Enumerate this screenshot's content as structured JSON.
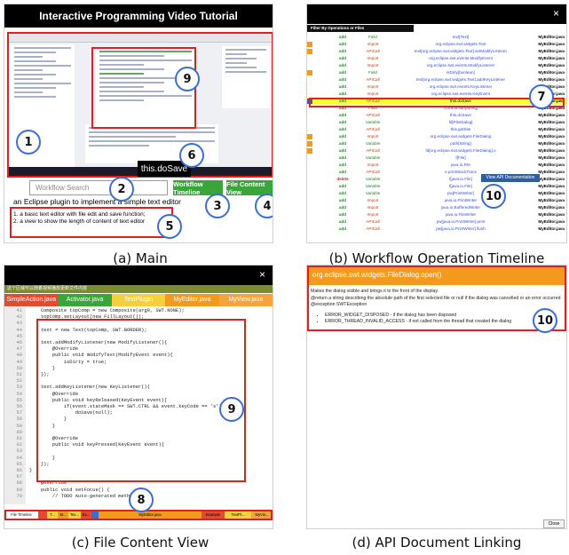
{
  "captions": {
    "a": "(a) Main",
    "b": "(b) Workflow Operation Timeline",
    "c": "(c) File Content View",
    "d": "(d) API Document Linking"
  },
  "panel_a": {
    "title": "Interactive Programming Video Tutorial",
    "tooltip": "this.doSave",
    "search_placeholder": "Workflow Search",
    "btn_timeline": "Workflow Timeline",
    "btn_filecontent": "File Content View",
    "desc_main": "an Eclipse plugin to implement a simple text editor",
    "desc_1": "1. a basic text editor with file edit and save function;",
    "desc_2": "2. a view to show the length of content of text editor",
    "accent": "#3aa63a"
  },
  "panel_b": {
    "close_glyph": "×",
    "filter_label": "Filter By Operations or Files",
    "popup": "View API Documentation",
    "rows": [
      {
        "action": "add",
        "kind": "Field",
        "detail": "text[Text]",
        "file": "MyEditor.java",
        "mark": ""
      },
      {
        "action": "add",
        "kind": "Import",
        "detail": "org.eclipse.swt.widgets.Text",
        "file": "MyEditor.java",
        "mark": "#f29a1e"
      },
      {
        "action": "add",
        "kind": "APICall",
        "detail": "text[org.eclipse.swt.widgets.Text].setModifyListener",
        "file": "MyEditor.java",
        "mark": "#f29a1e"
      },
      {
        "action": "add",
        "kind": "Import",
        "detail": "org.eclipse.swt.events.ModifyEvent",
        "file": "MyEditor.java",
        "mark": ""
      },
      {
        "action": "add",
        "kind": "Import",
        "detail": "org.eclipse.swt.events.ModifyListener",
        "file": "MyEditor.java",
        "mark": ""
      },
      {
        "action": "add",
        "kind": "Field",
        "detail": "isDirty[boolean]",
        "file": "MyEditor.java",
        "mark": "#f29a1e"
      },
      {
        "action": "add",
        "kind": "APICall",
        "detail": "text[org.eclipse.swt.widgets.Text].addKeyListener",
        "file": "MyEditor.java",
        "mark": ""
      },
      {
        "action": "add",
        "kind": "Import",
        "detail": "org.eclipse.swt.events.KeyListener",
        "file": "MyEditor.java",
        "mark": ""
      },
      {
        "action": "add",
        "kind": "Import",
        "detail": "org.eclipse.swt.events.KeyEvent",
        "file": "MyEditor.java",
        "mark": ""
      },
      {
        "action": "add",
        "kind": "APICall",
        "detail": "this.doSave",
        "file": "MyEditor.java",
        "mark": "#2a5fd8",
        "highlight": true
      },
      {
        "action": "add",
        "kind": "Field",
        "detail": "currentPath[String]",
        "file": "MyEditor.java",
        "mark": ""
      },
      {
        "action": "add",
        "kind": "APICall",
        "detail": "this.doSave",
        "file": "MyEditor.java",
        "mark": ""
      },
      {
        "action": "add",
        "kind": "Variable",
        "detail": "fd[FileDialog]",
        "file": "MyEditor.java",
        "mark": ""
      },
      {
        "action": "add",
        "kind": "APICall",
        "detail": "this.getSite",
        "file": "MyEditor.java",
        "mark": ""
      },
      {
        "action": "add",
        "kind": "Import",
        "detail": "org.eclipse.swt.widgets.FileDialog",
        "file": "MyEditor.java",
        "mark": "#f29a1e"
      },
      {
        "action": "add",
        "kind": "Variable",
        "detail": "path[String]",
        "file": "MyEditor.java",
        "mark": "#f29a1e"
      },
      {
        "action": "add",
        "kind": "APICall",
        "detail": "fd[org.eclipse.swt.widgets.FileDialog].o",
        "file": "MyEditor.java",
        "mark": "#f29a1e"
      },
      {
        "action": "add",
        "kind": "Variable",
        "detail": "f[File]",
        "file": "MyEditor.java",
        "mark": ""
      },
      {
        "action": "add",
        "kind": "Import",
        "detail": "java.io.File",
        "file": "MyEditor.java",
        "mark": ""
      },
      {
        "action": "add",
        "kind": "APICall",
        "detail": "e.printStackTrace",
        "file": "MyEditor.java",
        "mark": ""
      },
      {
        "action": "delete",
        "kind": "Variable",
        "detail": "f[java.io.File]",
        "file": "MyEditor.java",
        "mark": ""
      },
      {
        "action": "add",
        "kind": "Variable",
        "detail": "f[java.io.File]",
        "file": "MyEditor.java",
        "mark": ""
      },
      {
        "action": "add",
        "kind": "Variable",
        "detail": "pw[PrintWriter]",
        "file": "MyEditor.java",
        "mark": ""
      },
      {
        "action": "add",
        "kind": "Import",
        "detail": "java.io.PrintWriter",
        "file": "MyEditor.java",
        "mark": ""
      },
      {
        "action": "add",
        "kind": "Import",
        "detail": "java.io.BufferedWriter",
        "file": "MyEditor.java",
        "mark": ""
      },
      {
        "action": "add",
        "kind": "Import",
        "detail": "java.io.FileWriter",
        "file": "MyEditor.java",
        "mark": ""
      },
      {
        "action": "add",
        "kind": "APICall",
        "detail": "pw[java.io.PrintWriter].print",
        "file": "MyEditor.java",
        "mark": ""
      },
      {
        "action": "add",
        "kind": "APICall",
        "detail": "pw[java.io.PrintWriter].flush",
        "file": "MyEditor.java",
        "mark": ""
      }
    ]
  },
  "panel_c": {
    "close_glyph": "×",
    "banner": "这个区域可以随着视频播放更新文件内容",
    "tabs": [
      {
        "label": "SimpleAction.java",
        "color": "#e34a2f"
      },
      {
        "label": "Activator.java",
        "color": "#3aa63a"
      },
      {
        "label": "TextPlugin",
        "color": "#f4d03f"
      },
      {
        "label": "MyEditor.java",
        "color": "#f29a1e"
      },
      {
        "label": "MyView.java",
        "color": "#f4a43a"
      }
    ],
    "code": [
      {
        "ln": "41",
        "text": "    Composite topComp = new Composite(arg0, SWT.NONE);"
      },
      {
        "ln": "42",
        "text": "    topComp.setLayout(new FillLayout());"
      },
      {
        "ln": "43",
        "text": ""
      },
      {
        "ln": "44",
        "text": "    text = new Text(topComp, SWT.BORDER);"
      },
      {
        "ln": "45",
        "text": ""
      },
      {
        "ln": "46",
        "text": "    text.addModifyListener(new ModifyListener(){"
      },
      {
        "ln": "47",
        "text": "        @Override"
      },
      {
        "ln": "48",
        "text": "        public void modifyText(ModifyEvent event){"
      },
      {
        "ln": "49",
        "text": "            isDirty = true;"
      },
      {
        "ln": "50",
        "text": "        }"
      },
      {
        "ln": "51",
        "text": "    });"
      },
      {
        "ln": "52",
        "text": ""
      },
      {
        "ln": "53",
        "text": "    text.addKeyListener(new KeyListener(){"
      },
      {
        "ln": "54",
        "text": "        @Override"
      },
      {
        "ln": "55",
        "text": "        public void keyReleased(KeyEvent event){"
      },
      {
        "ln": "56",
        "text": "            if(event.stateMask == SWT.CTRL && event.keyCode == 's'){"
      },
      {
        "ln": "57",
        "text": "                doSave(null);"
      },
      {
        "ln": "58",
        "text": "            }"
      },
      {
        "ln": "59",
        "text": "        }"
      },
      {
        "ln": "60",
        "text": ""
      },
      {
        "ln": "61",
        "text": "        @Override"
      },
      {
        "ln": "62",
        "text": "        public void keyPressed(KeyEvent event){"
      },
      {
        "ln": "63",
        "text": ""
      },
      {
        "ln": "64",
        "text": "        }"
      },
      {
        "ln": "65",
        "text": "    });"
      },
      {
        "ln": "66",
        "text": "}"
      },
      {
        "ln": "67",
        "text": ""
      },
      {
        "ln": "68",
        "text": "    @Override"
      },
      {
        "ln": "69",
        "text": "    public void setFocus() {"
      },
      {
        "ln": "70",
        "text": "        // TODO Auto-generated method stub"
      }
    ],
    "timeline": [
      {
        "label": "File Timeline",
        "color": "#ffffff",
        "w": 38
      },
      {
        "label": "",
        "color": "#e34a2f",
        "w": 10
      },
      {
        "label": "T...",
        "color": "#f4d03f",
        "w": 12
      },
      {
        "label": "M...",
        "color": "#f29a1e",
        "w": 12
      },
      {
        "label": "Tex...",
        "color": "#f4d03f",
        "w": 14
      },
      {
        "label": "Ex...",
        "color": "#e34a2f",
        "w": 12
      },
      {
        "label": "",
        "color": "#3a6fd1",
        "w": 8
      },
      {
        "label": "MyEditor.java",
        "color": "#f29a1e",
        "w": 116
      },
      {
        "label": "Example",
        "color": "#e34a2f",
        "w": 26
      },
      {
        "label": "TextPl...",
        "color": "#f4d03f",
        "w": 30
      },
      {
        "label": "MyVie...",
        "color": "#f4a43a",
        "w": 24
      }
    ]
  },
  "panel_d": {
    "header": "org.eclipse.swt.widgets.FileDialog.open()",
    "line1": "Makes the dialog visible and brings it to the front of the display.",
    "line2": "@return a string describing the absolute path of the first selected file or null if the dialog was cancelled or an error occurred",
    "line3": "@exception SWTException",
    "bullet1": "ERROR_WIDGET_DISPOSED - if the dialog has been disposed",
    "bullet2": "ERROR_THREAD_INVALID_ACCESS - if not called from the thread that created the dialog",
    "close": "Close",
    "accent": "#f29a1e"
  },
  "markers": [
    "1",
    "2",
    "3",
    "4",
    "5",
    "6",
    "7",
    "8",
    "9",
    "9",
    "10",
    "10"
  ]
}
